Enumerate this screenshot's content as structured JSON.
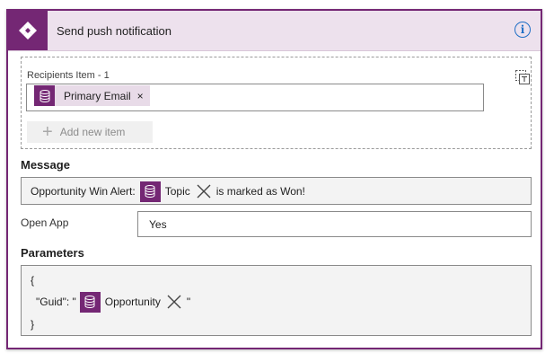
{
  "header": {
    "title": "Send push notification",
    "info_glyph": "i",
    "logo_icon": "diamond-grid-icon",
    "accent_color": "#742774"
  },
  "recipients": {
    "item_label": "Recipients Item - 1",
    "token_label": "Primary Email",
    "token_remove": "×",
    "add_label": "Add new item",
    "add_glyph": "+"
  },
  "message": {
    "label": "Message",
    "prefix": "Opportunity Win Alert:",
    "token_label": "Topic",
    "suffix": "is marked as Won!"
  },
  "open_app": {
    "label": "Open App",
    "value": "Yes"
  },
  "parameters": {
    "label": "Parameters",
    "line_open": "{",
    "key_text": "\"Guid\": \"",
    "token_label": "Opportunity",
    "after_token": "\"",
    "line_close": "}"
  }
}
